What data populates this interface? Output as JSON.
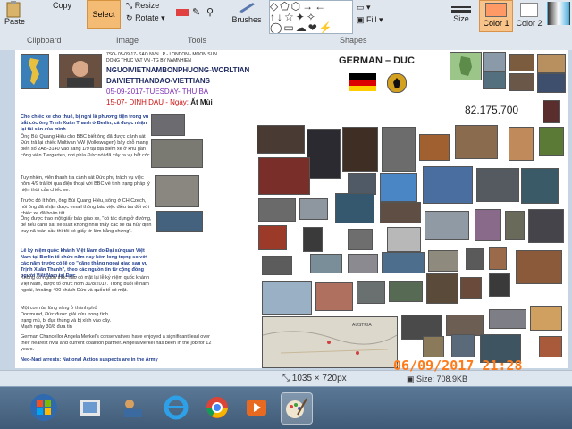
{
  "ribbon": {
    "clipboard_label": "Clipboard",
    "paste_label": "Paste",
    "copy_label": "Copy",
    "image_label": "Image",
    "select_label": "Select",
    "resize_label": "Resize",
    "rotate_label": "Rotate",
    "tools_label": "Tools",
    "brushes_label": "Brushes",
    "shapes_label": "Shapes",
    "fill_label": "Fill",
    "size_label": "Size",
    "color1_label": "Color 1",
    "color2_label": "Color 2"
  },
  "doc": {
    "top_small_1": "7SO- 05-09-17- SAO NVN...P - LONDON - MOON SUN",
    "top_small_2": "DONG THUC VAT VN -TG BY NAMNHIEN",
    "line_1": "NGUOIVIETNAMBONPHUONG-WORLTIAN",
    "line_2": "DAIVIETTHANDAO-VIETTIANS",
    "date_line": "05-09-2017-TUESDAY- THU BA",
    "line_4a": "15-07- DINH DAU - Ngày: ",
    "line_4b": "Ất Mùi",
    "title_right": "GERMAN – DUC",
    "number": "82.175.700",
    "para_1_title": "Cho chiếc xe cho thuê, bị nghi là phương tiện trong vụ bắt cóc ông Trịnh Xuân Thanh ở Berlin, cả được nhận lại tài sản của mình.",
    "para_1": "Ông Bùi Quang Hiếu cho BBC biết ông đã được cảnh sát Đức trả lại chiếc Multivan VW (Volkswagen) bảy chỗ mang biển số 2AB-3140 vào sáng 1/9 tại địa điểm xe ở khu gần công viên Tiergarten, nơi phía Đức nói đã xảy ra vụ bắt cóc.",
    "para_2": "Tuy nhiên, viên thanh tra cảnh sát Đức phụ trách vụ việc hôm 4/9 trả lời qua điện thoại với BBC về tình trạng pháp lý hiện thời của chiếc xe.",
    "para_3": "Trước đó ít hôm, ông Bùi Quang Hiếu, sống ở CH Czech, nói ông đã nhận được email thông báo việc điều tra đối với chiếc xe đã hoàn tất.",
    "para_4": "Ông được trao một giấy báo giao xe, \"có tác dụng ở đường, để nếu cảnh sát xe suất không nhìn thấy các xe đã hủy định truy nã toàn cầu thì tôi có giấy tờ làm bằng chứng\".",
    "para_5_title": "Lễ kỷ niệm quốc khánh Việt Nam do Đại sứ quán Việt Nam tại Berlin tổ chức năm nay kém long trọng so với các năm trước có lẽ do \"căng thẳng ngoại giao sau vụ Trịnh Xuân Thanh\", theo các nguồn tin từ cộng đồng người Việt Nam tại Đức.",
    "para_5": "Không có nguồn thúc nào có mặt lại lễ kỷ niệm quốc khánh Việt Nam, được tổ chức hôm 31/8/2017. Trong buổi lễ năm ngoái, khoảng 400 khách Đức và quốc tế có mặt.",
    "para_6": "Một con rùa lùng vàng ở thành phố Dortmund, Đức được giải cứu trong tình trạng mù, bị đục thủng và bị xích vào cây. Mạch ngày 30/8 đưa tin",
    "para_7": "German Chancellor Angela Merkel's conservatives have enjoyed a significant lead over their nearest rival and current coalition partner. Angela Merkel has been in the job for 12 years.",
    "para_8": "Neo-Nazi arrests: National Action suspects are in the Army",
    "map_label": "AUSTRIA"
  },
  "status": {
    "dimensions": "1035 × 720px",
    "size": "Size: 708.9KB"
  },
  "camera_stamp": "06/09/2017 21:28",
  "colors": {
    "ribbon_bg": "#dfe6ee",
    "canvas_bg": "#c7d4e3",
    "stamp": "#ff7b1a",
    "heading_blue": "#1e3c8c",
    "date_purple": "#7b2fb5",
    "red_line": "#cc1111"
  }
}
